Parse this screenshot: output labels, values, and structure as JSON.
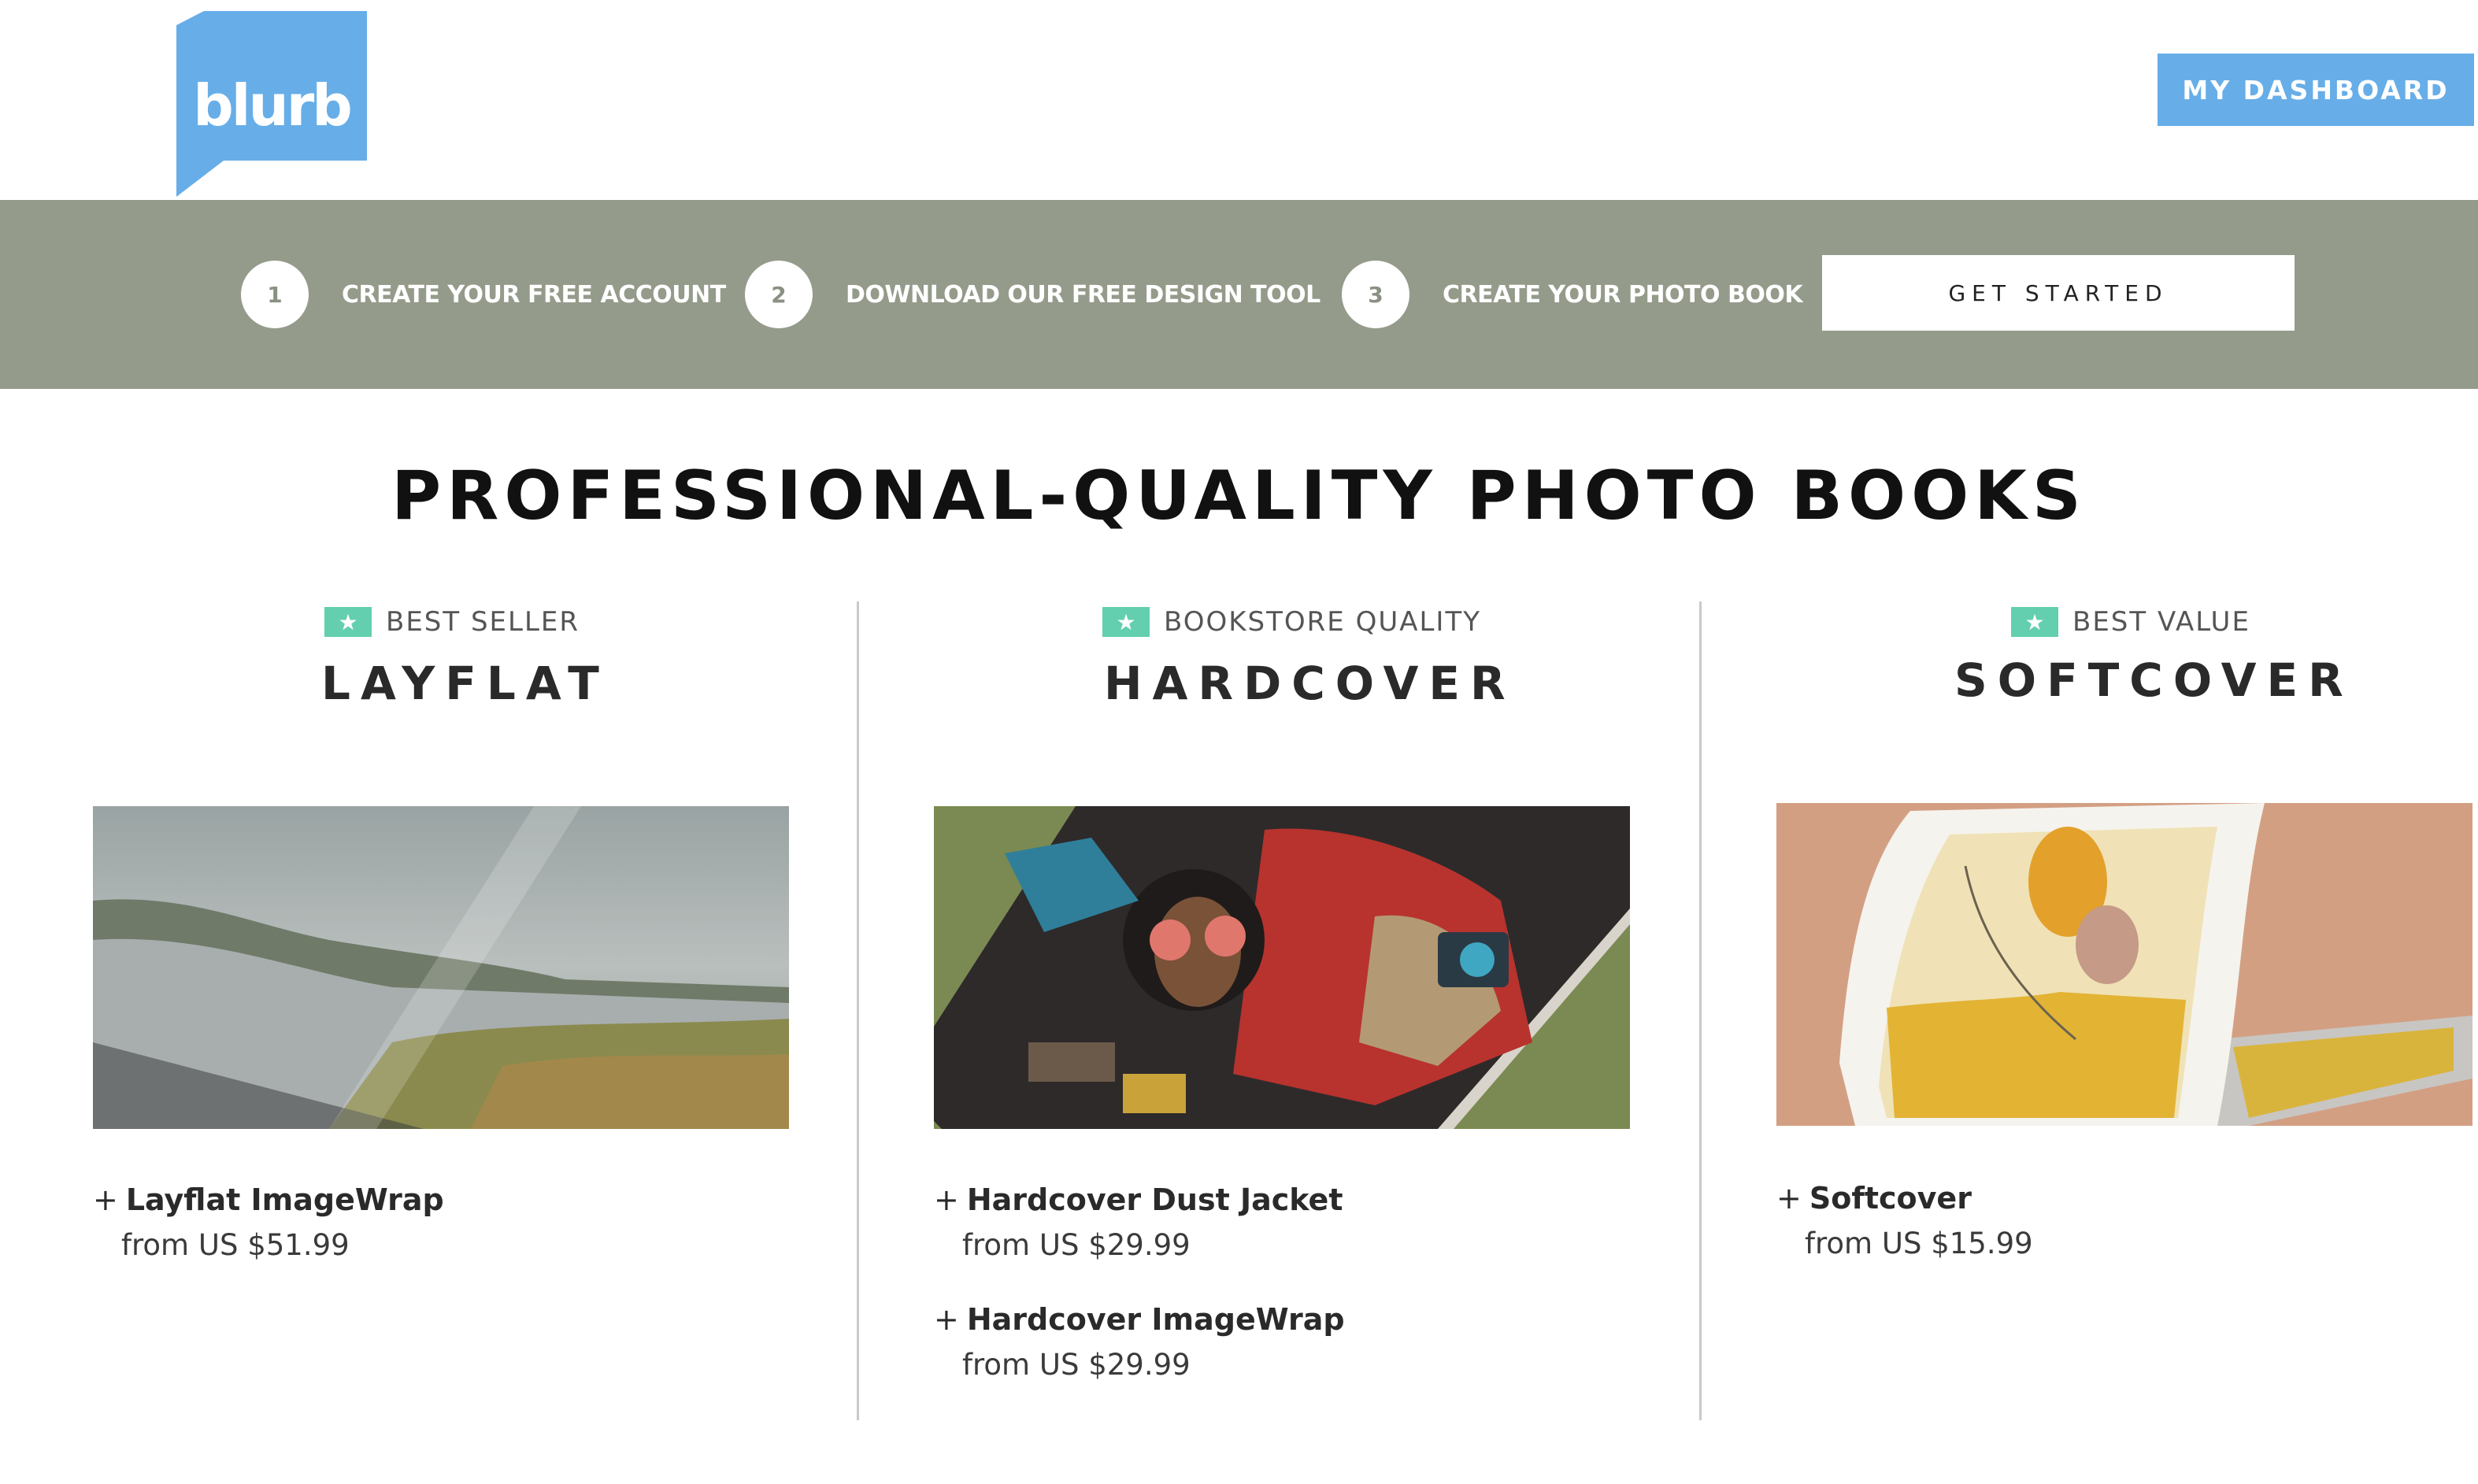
{
  "header": {
    "logo_text": "blurb",
    "dashboard_label": "MY DASHBOARD",
    "logo_color": "#67aee8"
  },
  "steps": [
    {
      "number": "1",
      "label": "CREATE YOUR FREE ACCOUNT"
    },
    {
      "number": "2",
      "label": "DOWNLOAD OUR FREE DESIGN TOOL"
    },
    {
      "number": "3",
      "label": "CREATE YOUR PHOTO BOOK"
    }
  ],
  "steps_bar": {
    "cta_label": "GET STARTED",
    "background_color": "#949b8b"
  },
  "main": {
    "title": "PROFESSIONAL-QUALITY PHOTO BOOKS"
  },
  "columns": [
    {
      "badge": "BEST SELLER",
      "title": "LAYFLAT",
      "image_icon": "layflat-book-photo",
      "options": [
        {
          "name": "Layflat ImageWrap",
          "price": "from US $51.99"
        }
      ]
    },
    {
      "badge": "BOOKSTORE QUALITY",
      "title": "HARDCOVER",
      "image_icon": "hardcover-book-photo",
      "options": [
        {
          "name": "Hardcover Dust Jacket",
          "price": "from US $29.99"
        },
        {
          "name": "Hardcover ImageWrap",
          "price": "from US $29.99"
        }
      ]
    },
    {
      "badge": "BEST VALUE",
      "title": "SOFTCOVER",
      "image_icon": "softcover-book-photo",
      "options": [
        {
          "name": "Softcover",
          "price": "from US $15.99"
        }
      ]
    }
  ],
  "colors": {
    "badge_green": "#63cfaf",
    "divider": "#c9c9c9"
  }
}
